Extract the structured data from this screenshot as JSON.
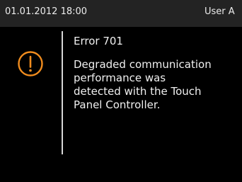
{
  "status_bar": {
    "datetime": "01.01.2012 18:00",
    "user": "User A"
  },
  "dialog": {
    "icon": "warning-exclamation-icon",
    "accent_color": "#f08c1e",
    "title": "Error 701",
    "message_lines": [
      "Degraded communication",
      "performance was",
      "detected with the Touch",
      "Panel Controller."
    ]
  }
}
